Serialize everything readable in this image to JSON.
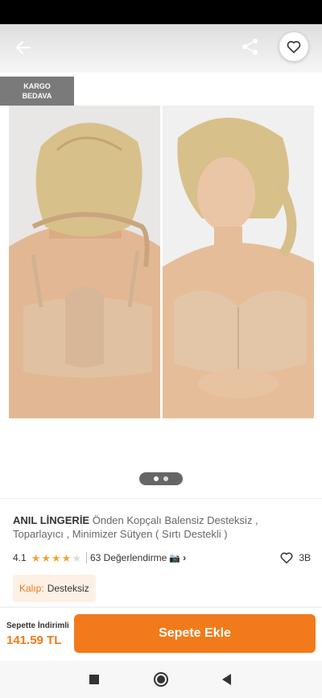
{
  "gallery": {
    "badge_line1": "KARGO",
    "badge_line2": "BEDAVA",
    "page_count": 2,
    "current_page": 1
  },
  "product": {
    "brand": "ANIL LİNGERİE",
    "title": "Önden Kopçalı Balensiz Desteksiz , Toparlayıcı , Minimizer Sütyen ( Sırtı Destekli )"
  },
  "rating": {
    "score": "4.1",
    "stars_filled": 4,
    "reviews_label": "63 Değerlendirme",
    "favorites_count": "3B"
  },
  "attributes": {
    "kalip_key": "Kalıp:",
    "kalip_value": "Desteksiz"
  },
  "bottom_bar": {
    "discount_label": "Sepette İndirimli",
    "price": "141.59 TL",
    "add_to_cart_label": "Sepete Ekle"
  },
  "colors": {
    "accent": "#f27a1a",
    "star": "#f1a33b"
  },
  "icons": [
    "back-arrow-icon",
    "share-icon",
    "heart-icon",
    "camera-icon",
    "chevron-right-icon"
  ]
}
